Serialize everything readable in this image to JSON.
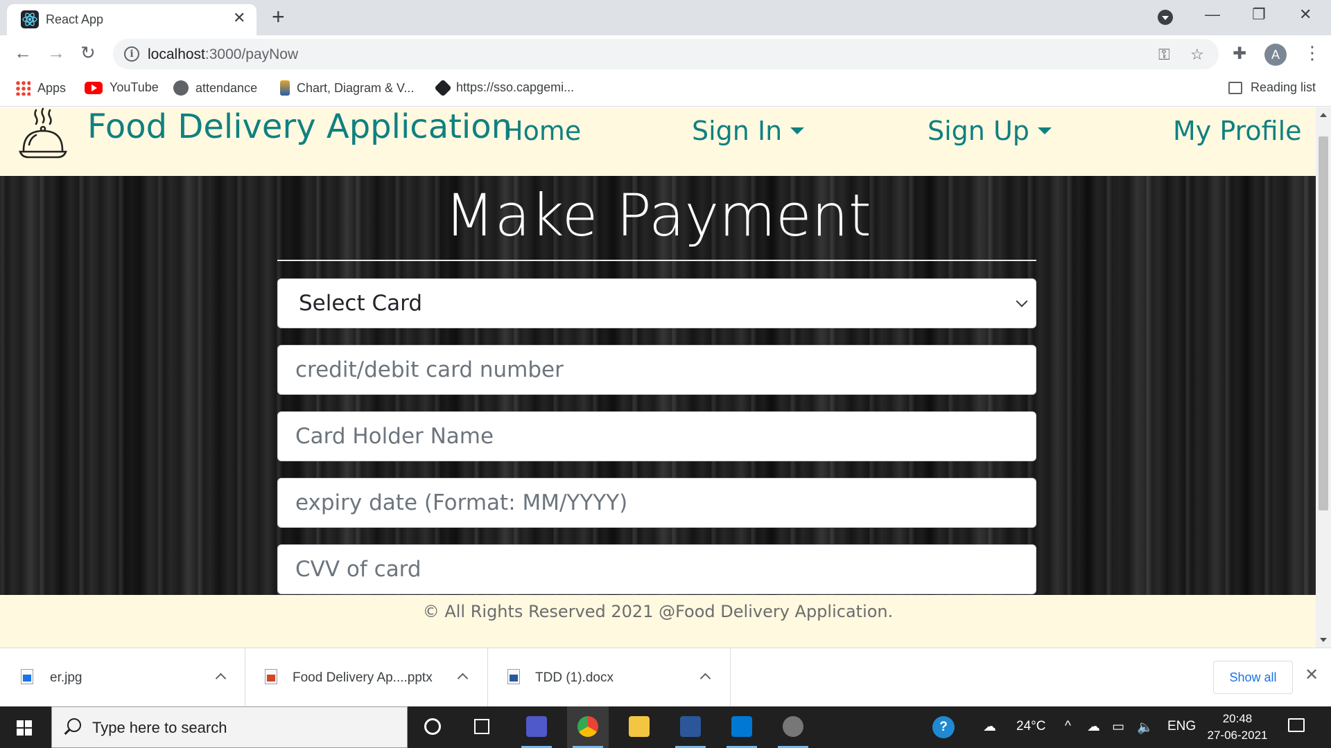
{
  "browser": {
    "tab": {
      "title": "React App",
      "favicon": "react-icon"
    },
    "address": {
      "host": "localhost",
      "path": ":3000/payNow"
    },
    "bookmarks": [
      {
        "label": "Apps",
        "icon": "apps-grid-icon"
      },
      {
        "label": "YouTube",
        "icon": "youtube-icon"
      },
      {
        "label": "attendance",
        "icon": "globe-icon"
      },
      {
        "label": "Chart, Diagram & V...",
        "icon": "chart-icon"
      },
      {
        "label": "https://sso.capgemi...",
        "icon": "sso-icon"
      }
    ],
    "reading_list": "Reading list",
    "profile_initial": "A"
  },
  "app": {
    "brand": "Food Delivery Application",
    "nav": {
      "home": "Home",
      "sign_in": "Sign In",
      "sign_up": "Sign Up",
      "profile": "My Profile"
    },
    "page_title": "Make Payment",
    "form": {
      "select_card": "Select Card",
      "card_number_placeholder": "credit/debit card number",
      "holder_placeholder": "Card Holder Name",
      "expiry_placeholder": "expiry date (Format: MM/YYYY)",
      "cvv_placeholder": "CVV of card"
    },
    "footer": "© All Rights Reserved 2021 @Food Delivery Application.",
    "colors": {
      "brand": "#108080",
      "navbar_bg": "#fff9e0"
    }
  },
  "downloads": {
    "items": [
      {
        "name": "er.jpg",
        "icon": "image-file-icon"
      },
      {
        "name": "Food Delivery Ap....pptx",
        "icon": "powerpoint-file-icon"
      },
      {
        "name": "TDD (1).docx",
        "icon": "word-file-icon"
      }
    ],
    "show_all": "Show all"
  },
  "taskbar": {
    "search_placeholder": "Type here to search",
    "weather": "24°C",
    "language": "ENG",
    "time": "20:48",
    "date": "27-06-2021"
  }
}
